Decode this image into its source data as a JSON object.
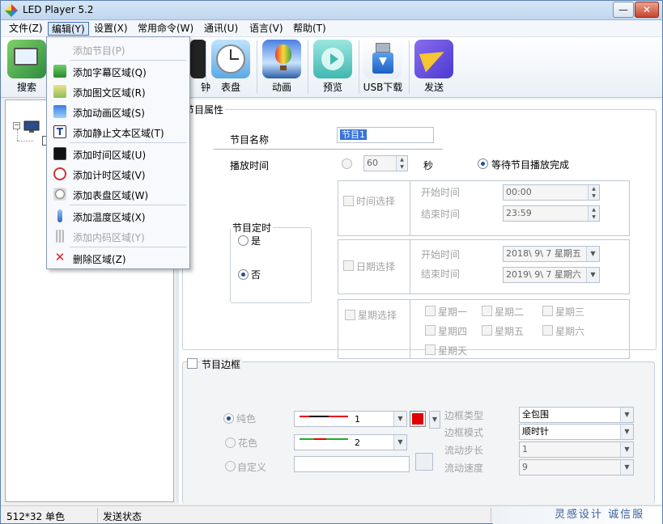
{
  "window": {
    "title": "LED Player 5.2",
    "min_symbol": "—",
    "close_symbol": "✕"
  },
  "menu": [
    "文件(Z)",
    "编辑(Y)",
    "设置(X)",
    "常用命令(W)",
    "通讯(U)",
    "语言(V)",
    "帮助(T)"
  ],
  "toolbar": {
    "search": "搜索",
    "clock": "钟",
    "dial": "表盘",
    "animation": "动画",
    "preview": "预览",
    "usb": "USB下载",
    "send": "发送"
  },
  "dropdown": {
    "items": [
      {
        "label": "添加节目(P)",
        "enabled": false,
        "icon": "none"
      },
      {
        "label": "添加字幕区域(Q)",
        "enabled": true,
        "icon": "subtitle-icon"
      },
      {
        "label": "添加图文区域(R)",
        "enabled": true,
        "icon": "image-text-icon"
      },
      {
        "label": "添加动画区域(S)",
        "enabled": true,
        "icon": "animation-icon"
      },
      {
        "label": "添加静止文本区域(T)",
        "enabled": true,
        "icon": "static-text-icon"
      },
      {
        "label": "添加时间区域(U)",
        "enabled": true,
        "icon": "digital-time-icon"
      },
      {
        "label": "添加计时区域(V)",
        "enabled": true,
        "icon": "timer-icon"
      },
      {
        "label": "添加表盘区域(W)",
        "enabled": true,
        "icon": "dial-icon"
      },
      {
        "label": "添加温度区域(X)",
        "enabled": true,
        "icon": "thermometer-icon"
      },
      {
        "label": "添加内码区域(Y)",
        "enabled": false,
        "icon": "code-icon"
      },
      {
        "label": "删除区域(Z)",
        "enabled": true,
        "icon": "delete-icon"
      }
    ]
  },
  "props": {
    "group_title": "节目属性",
    "name_label": "节目名称",
    "name_value": "节目1",
    "play_time_label": "播放时间",
    "play_seconds": "60",
    "seconds_unit": "秒",
    "wait_label": "等待节目播放完成",
    "schedule": {
      "title": "节目定时",
      "yes": "是",
      "no": "否"
    },
    "time_select": "时间选择",
    "start_time_label": "开始时间",
    "start_time": "00:00",
    "end_time_label": "结束时间",
    "end_time": "23:59",
    "date_select": "日期选择",
    "start_date_label": "开始时间",
    "start_date": "2018\\ 9\\ 7 星期五",
    "end_date_label": "结束时间",
    "end_date": "2019\\ 9\\ 7 星期六",
    "week_select": "星期选择",
    "weekdays": [
      "星期一",
      "星期二",
      "星期三",
      "星期四",
      "星期五",
      "星期六",
      "星期天"
    ]
  },
  "border": {
    "title": "节目边框",
    "solid": "纯色",
    "pattern": "花色",
    "custom": "自定义",
    "solid_value": "1",
    "pattern_value": "2",
    "type_label": "边框类型",
    "type_value": "全包围",
    "mode_label": "边框模式",
    "mode_value": "顺时针",
    "step_label": "流动步长",
    "step_value": "1",
    "speed_label": "流动速度",
    "speed_value": "9",
    "color": "#e00000"
  },
  "status": {
    "screen": "512*32 单色",
    "send_state": "发送状态",
    "brand": "灵感设计  诚信服"
  }
}
